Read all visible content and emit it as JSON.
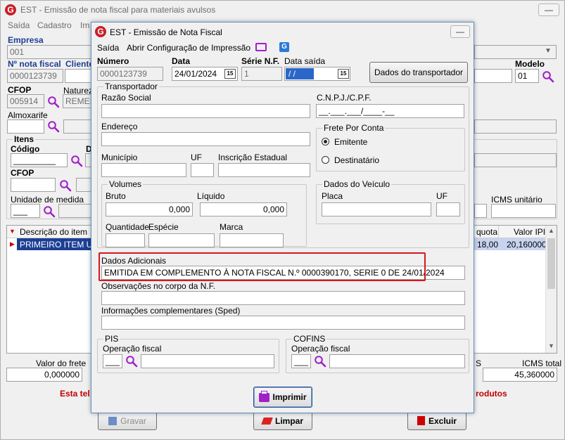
{
  "main": {
    "title": "EST - Emissão de nota fiscal para materiais avulsos",
    "menu": [
      "Saída",
      "Cadastro",
      "Im"
    ],
    "empresa_label": "Empresa",
    "empresa_value": "001",
    "nota_label": "Nº nota fiscal",
    "nota_value": "0000123739",
    "cliente_label": "Cliente",
    "modelo_label": "Modelo",
    "modelo_value": "01",
    "cfop_label": "CFOP",
    "cfop_value": "005914",
    "natureza_label": "Naturez",
    "natureza_value": "REMES",
    "almox_label": "Almoxarife",
    "itens_label": "Itens",
    "codigo_label": "Código",
    "codigo_value": "_________",
    "d_label": "D",
    "cfop2_label": "CFOP",
    "unid_label": "Unidade de medida",
    "unid_value": "___",
    "icms_unit_label": "ICMS unitário",
    "table_headers": {
      "desc": "Descrição do item",
      "quota": "quota",
      "ipi": "Valor IPI"
    },
    "row": {
      "desc": "PRIMEIRO ITEM UT",
      "quota": "18,00",
      "ipi": "20,160000"
    },
    "frete_label": "Valor do frete",
    "frete_value": "0,000000",
    "icms_total_label": "ICMS total",
    "icms_total_value": "45,360000",
    "s_label": "S",
    "warning_left": "Esta tel",
    "warning_right": "rodutos",
    "btn_gravar": "Gravar",
    "btn_limpar": "Limpar",
    "btn_excluir": "Excluir"
  },
  "dialog": {
    "title": "EST - Emissão de Nota Fiscal",
    "menu_saida": "Saída",
    "menu_config": "Abrir Configuração de Impressão",
    "numero_label": "Número",
    "numero_value": "0000123739",
    "data_label": "Data",
    "data_value": "24/01/2024",
    "serie_label": "Série N.F.",
    "serie_value": "1",
    "datasaida_label": "Data saída",
    "datasaida_value": " / /",
    "btn_transportador": "Dados do transportador",
    "transp_group": "Transportador",
    "razao_label": "Razão Social",
    "cnpj_label": "C.N.P.J./C.P.F.",
    "cnpj_value": "__.___.___/____-__",
    "endereco_label": "Endereço",
    "frete_group": "Frete Por Conta",
    "emitente": "Emitente",
    "destinatario": "Destinatário",
    "municipio_label": "Município",
    "uf_label": "UF",
    "inscricao_label": "Inscrição Estadual",
    "volumes_group": "Volumes",
    "bruto_label": "Bruto",
    "bruto_value": "0,000",
    "liquido_label": "Líquido",
    "liquido_value": "0,000",
    "quantidade_label": "Quantidade",
    "especie_label": "Espécie",
    "marca_label": "Marca",
    "veiculo_group": "Dados do Veículo",
    "placa_label": "Placa",
    "uf2_label": "UF",
    "dados_adic_label": "Dados Adicionais",
    "dados_adic_value": "EMITIDA EM COMPLEMENTO À NOTA FISCAL N.º 0000390170, SERIE  0 DE 24/01/2024",
    "obs_label": "Observações no corpo da N.F.",
    "info_label": "Informações complementares (Sped)",
    "pis_group": "PIS",
    "pis_op_label": "Operação fiscal",
    "pis_op_value": "___",
    "cofins_group": "COFINS",
    "cofins_op_label": "Operação fiscal",
    "cofins_op_value": "___",
    "btn_imprimir": "Imprimir",
    "highlight_color": "#d9161c"
  }
}
